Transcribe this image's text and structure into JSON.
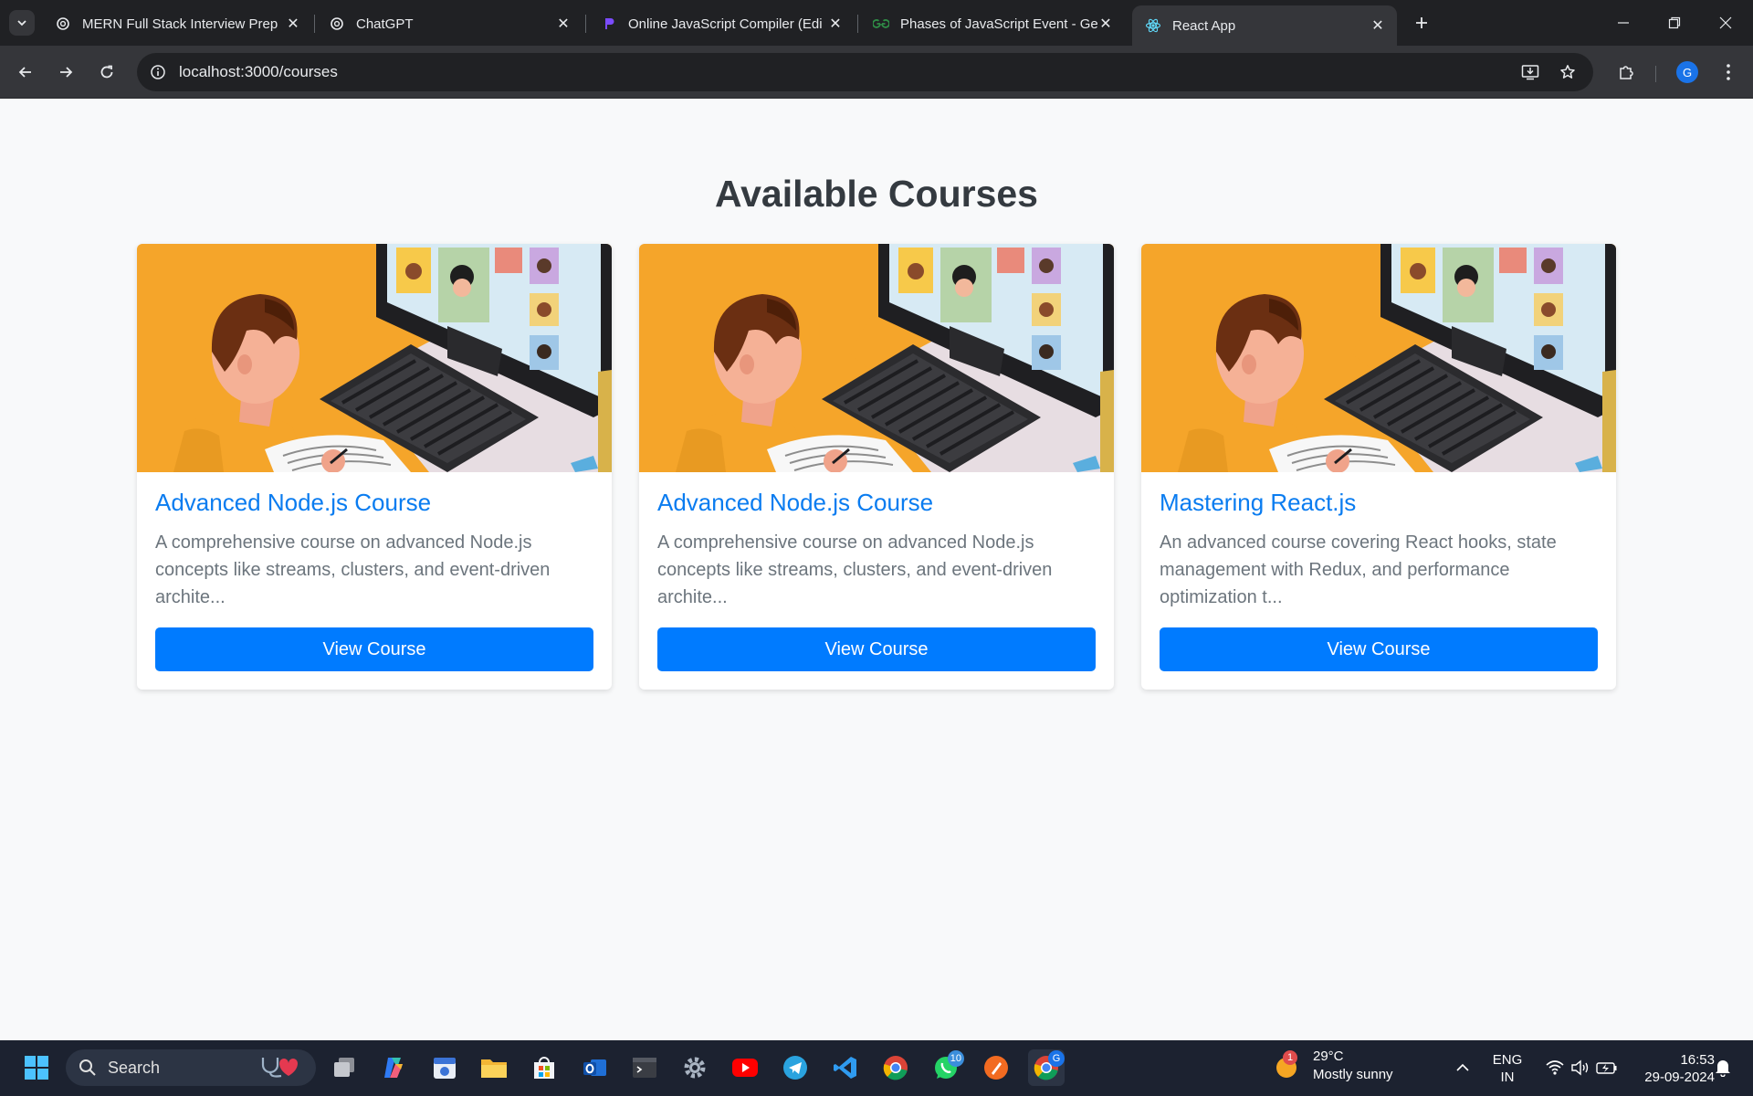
{
  "browser": {
    "tabs": [
      {
        "title": "MERN Full Stack Interview Prep",
        "icon": "openai-icon",
        "active": false
      },
      {
        "title": "ChatGPT",
        "icon": "openai-icon",
        "active": false
      },
      {
        "title": "Online JavaScript Compiler (Edi",
        "icon": "compiler-icon",
        "active": false
      },
      {
        "title": "Phases of JavaScript Event - Gee",
        "icon": "geeksforgeeks-icon",
        "active": false
      },
      {
        "title": "React App",
        "icon": "react-icon",
        "active": true
      }
    ],
    "url": "localhost:3000/courses",
    "profile_initial": "G"
  },
  "page": {
    "heading": "Available Courses",
    "courses": [
      {
        "title": "Advanced Node.js Course",
        "description": "A comprehensive course on advanced Node.js concepts like streams, clusters, and event-driven archite...",
        "button": "View Course"
      },
      {
        "title": "Advanced Node.js Course",
        "description": "A comprehensive course on advanced Node.js concepts like streams, clusters, and event-driven archite...",
        "button": "View Course"
      },
      {
        "title": "Mastering React.js",
        "description": "An advanced course covering React hooks, state management with Redux, and performance optimization t...",
        "button": "View Course"
      }
    ]
  },
  "taskbar": {
    "search_label": "Search",
    "whatsapp_badge": "10",
    "chrome_badge": "G",
    "weather": {
      "alert": "1",
      "temp": "29°C",
      "condition": "Mostly sunny"
    },
    "language": {
      "line1": "ENG",
      "line2": "IN"
    },
    "time": "16:53",
    "date": "29-09-2024"
  },
  "colors": {
    "accent_blue": "#007bff",
    "title_blue": "#0a7cf0",
    "course_orange": "#f5a52a"
  }
}
